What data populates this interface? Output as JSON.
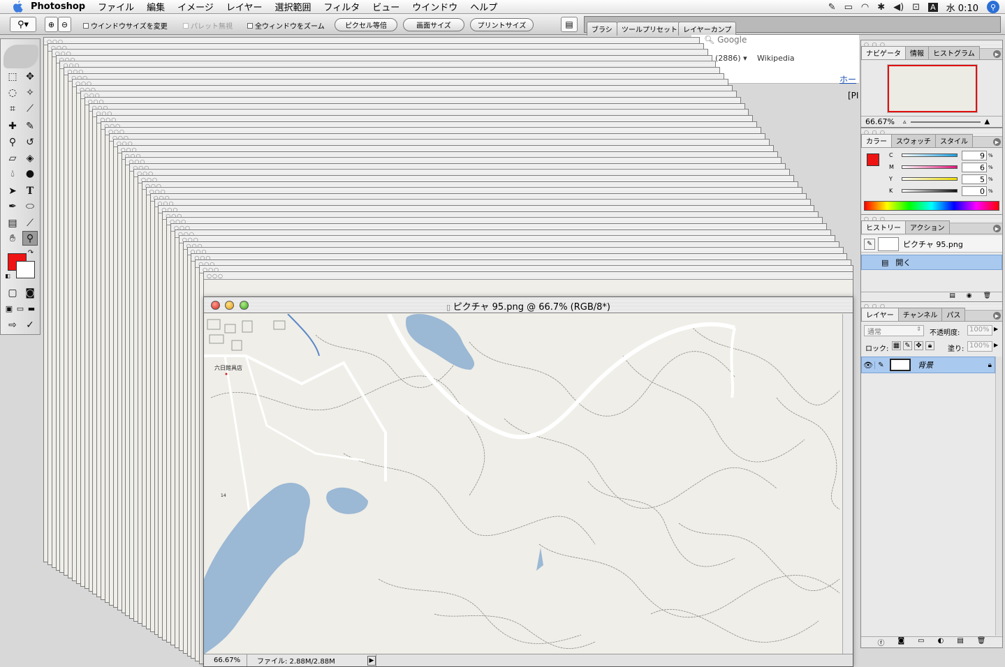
{
  "menubar": {
    "app": "Photoshop",
    "items": [
      "ファイル",
      "編集",
      "イメージ",
      "レイヤー",
      "選択範囲",
      "フィルタ",
      "ビュー",
      "ウインドウ",
      "ヘルプ"
    ],
    "clock": "水 0:10",
    "icons": [
      "apple-icon",
      "script-icon",
      "battery-icon",
      "wifi-icon",
      "bluetooth-icon",
      "volume-icon",
      "display-icon",
      "input-method-icon",
      "spotlight-icon"
    ]
  },
  "options": {
    "resize_windows": "ウインドウサイズを変更",
    "ignore_palettes": "パレット無視",
    "zoom_all": "全ウィンドウをズーム",
    "actual_pixels": "ピクセル等倍",
    "fit_screen": "画面サイズ",
    "print_size": "プリントサイズ",
    "well_tabs": [
      "ブラシ",
      "ツールプリセット",
      "レイヤーカンプ"
    ]
  },
  "browser": {
    "search": "Google",
    "bookmark_count": "(2886) ▾",
    "bookmark_wiki": "Wikipedia",
    "home_link": "ホー",
    "bracket": "[PI"
  },
  "document": {
    "title": "ピクチャ 95.png @ 66.7% (RGB/8*)",
    "zoom": "66.67%",
    "file_info": "ファイル: 2.88M/2.88M",
    "map_label": "六日館具店",
    "map_number": "14"
  },
  "navigator": {
    "tabs": [
      "ナビゲータ",
      "情報",
      "ヒストグラム"
    ],
    "zoom": "66.67%"
  },
  "color": {
    "tabs": [
      "カラー",
      "スウォッチ",
      "スタイル"
    ],
    "channels": [
      {
        "label": "C",
        "value": "9",
        "color": "#1a9fe0"
      },
      {
        "label": "M",
        "value": "6",
        "color": "#e0157a"
      },
      {
        "label": "Y",
        "value": "5",
        "color": "#f0e000"
      },
      {
        "label": "K",
        "value": "0",
        "color": "#111111"
      }
    ],
    "foreground": "#ef1414"
  },
  "history": {
    "tabs": [
      "ヒストリー",
      "アクション"
    ],
    "snapshot": "ピクチャ 95.png",
    "steps": [
      "開く"
    ]
  },
  "layers": {
    "tabs": [
      "レイヤー",
      "チャンネル",
      "パス"
    ],
    "blend_mode": "通常",
    "opacity_label": "不透明度:",
    "opacity": "100%",
    "lock_label": "ロック:",
    "fill_label": "塗り:",
    "fill": "100%",
    "layer_name": "背景"
  }
}
